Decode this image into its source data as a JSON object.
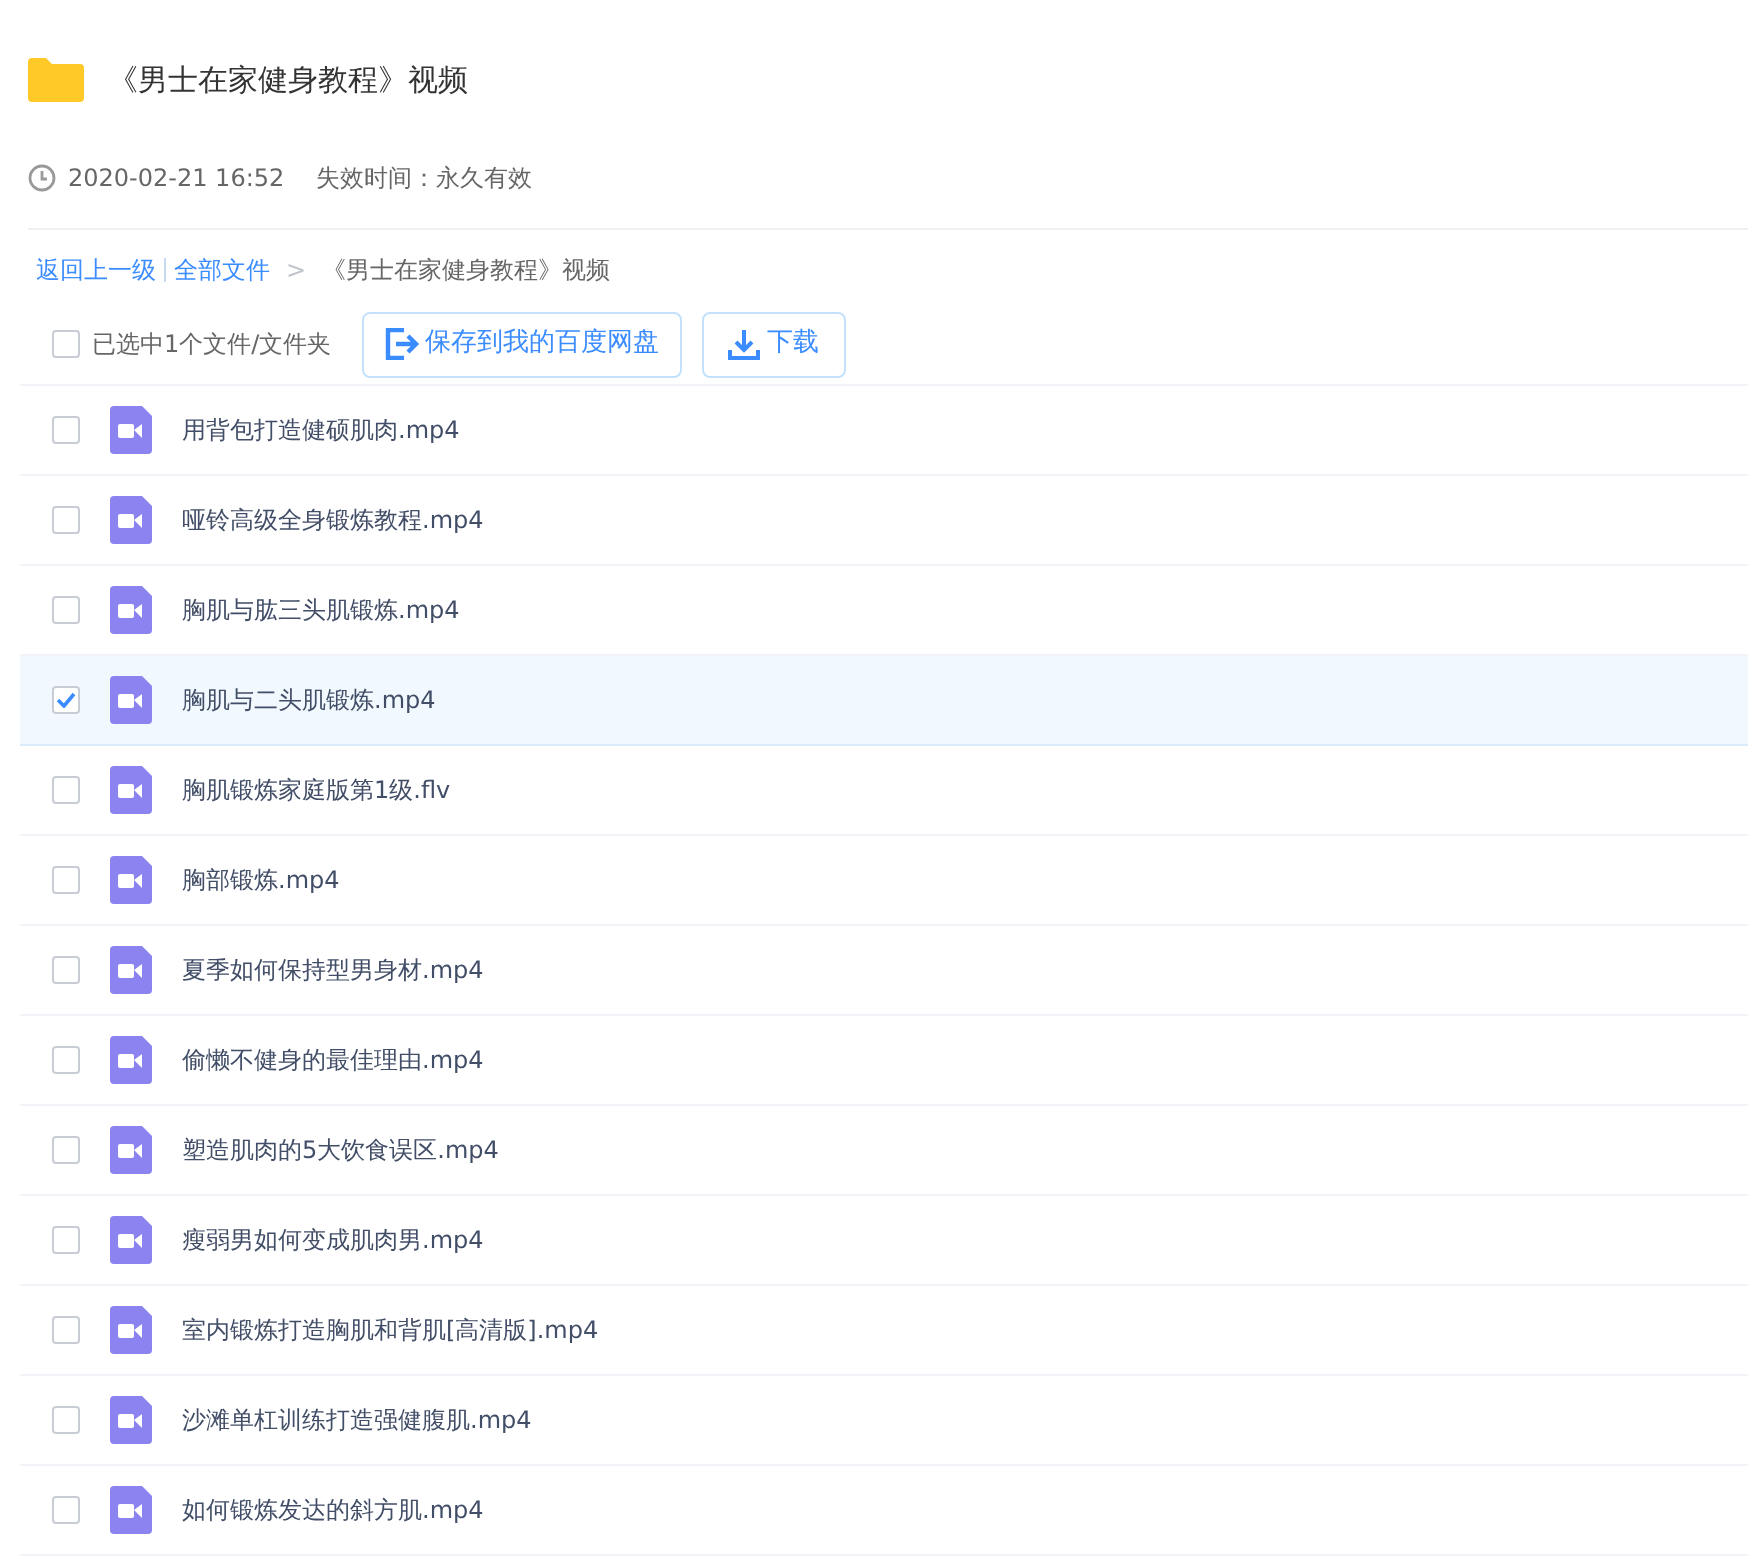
{
  "title": "《男士在家健身教程》视频",
  "meta": {
    "date": "2020-02-21 16:52",
    "expiry": "失效时间：永久有效"
  },
  "breadcrumb": {
    "back": "返回上一级",
    "all": "全部文件",
    "separator": ">",
    "current": "《男士在家健身教程》视频"
  },
  "toolbar": {
    "select_all": {
      "label": "已选中1个文件/文件夹",
      "checked": false
    },
    "save_button": "保存到我的百度网盘",
    "download_button": "下载"
  },
  "files": [
    {
      "name": "用背包打造健硕肌肉.mp4",
      "selected": false
    },
    {
      "name": "哑铃高级全身锻炼教程.mp4",
      "selected": false
    },
    {
      "name": "胸肌与肱三头肌锻炼.mp4",
      "selected": false
    },
    {
      "name": "胸肌与二头肌锻炼.mp4",
      "selected": true
    },
    {
      "name": "胸肌锻炼家庭版第1级.flv",
      "selected": false
    },
    {
      "name": "胸部锻炼.mp4",
      "selected": false
    },
    {
      "name": "夏季如何保持型男身材.mp4",
      "selected": false
    },
    {
      "name": "偷懒不健身的最佳理由.mp4",
      "selected": false
    },
    {
      "name": "塑造肌肉的5大饮食误区.mp4",
      "selected": false
    },
    {
      "name": "瘦弱男如何变成肌肉男.mp4",
      "selected": false
    },
    {
      "name": "室内锻炼打造胸肌和背肌[高清版].mp4",
      "selected": false
    },
    {
      "name": "沙滩单杠训练打造强健腹肌.mp4",
      "selected": false
    },
    {
      "name": "如何锻炼发达的斜方肌.mp4",
      "selected": false
    }
  ]
}
